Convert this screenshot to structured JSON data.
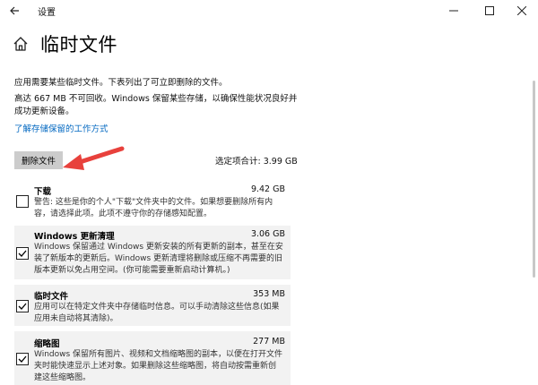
{
  "window": {
    "title": "设置",
    "controls": {
      "minimize": "minimize-icon",
      "maximize": "maximize-icon",
      "close": "close-icon"
    }
  },
  "header": {
    "title": "临时文件",
    "home_icon": "home-icon"
  },
  "description": {
    "line1": "应用需要某些临时文件。下表列出了可立即删除的文件。",
    "line2": "高达 667 MB 不可回收。Windows 保留某些存储，以确保性能状况良好并成功更新设备。",
    "link": "了解存储保留的工作方式"
  },
  "actions": {
    "delete_label": "删除文件",
    "selected_total": "选定项合计: 3.99 GB"
  },
  "items": [
    {
      "name": "下载",
      "size": "9.42 GB",
      "checked": false,
      "description": "警告: 这些是你的个人\"下载\"文件夹中的文件。如果想要删除所有内容，请选择此项。此项不遵守你的存储感知配置。"
    },
    {
      "name": "Windows 更新清理",
      "size": "3.06 GB",
      "checked": true,
      "description": "Windows 保留通过 Windows 更新安装的所有更新的副本，甚至在安装了新版本的更新后。Windows 更新清理将删除或压缩不再需要的旧版本更新以免占用空间。(你可能需要重新启动计算机。)"
    },
    {
      "name": "临时文件",
      "size": "353 MB",
      "checked": true,
      "description": "应用可以在特定文件夹中存储临时信息。可以手动清除这些信息(如果应用未自动将其清除)。"
    },
    {
      "name": "缩略图",
      "size": "277 MB",
      "checked": true,
      "description": "Windows 保留所有图片、视频和文档缩略图的副本，以便在打开文件夹时能快速显示上述对象。如果删除这些缩略图，将自动按需重新创建这些缩略图。"
    }
  ],
  "colors": {
    "link": "#0067c0",
    "button": "#cccccc",
    "arrow": "#e8413c",
    "selected_row": "#f2f2f2"
  }
}
